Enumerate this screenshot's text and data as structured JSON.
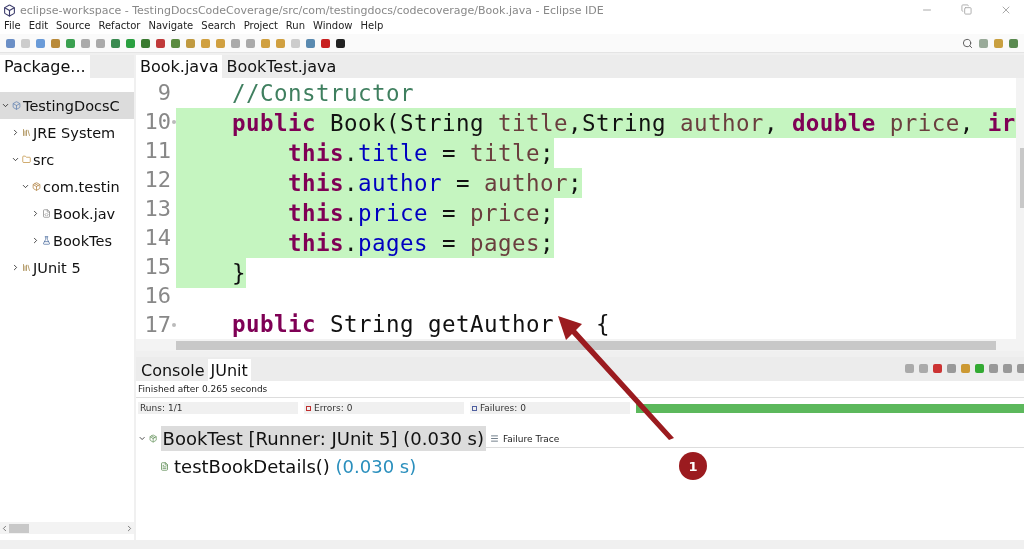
{
  "window": {
    "title": "eclipse-workspace - TestingDocsCodeCoverage/src/com/testingdocs/codecoverage/Book.java - Eclipse IDE"
  },
  "menu": [
    "File",
    "Edit",
    "Source",
    "Refactor",
    "Navigate",
    "Search",
    "Project",
    "Run",
    "Window",
    "Help"
  ],
  "package_explorer": {
    "tab": "Package...",
    "tree": [
      {
        "label": "TestingDocsC",
        "kind": "project",
        "expanded": true,
        "selected": true,
        "children": [
          {
            "label": "JRE System",
            "kind": "library",
            "expanded": false,
            "selected": false
          },
          {
            "label": "src",
            "kind": "folder",
            "expanded": true,
            "selected": false,
            "children": [
              {
                "label": "com.testin",
                "kind": "package",
                "expanded": true,
                "selected": false,
                "children": [
                  {
                    "label": "Book.jav",
                    "kind": "class",
                    "expanded": false,
                    "selected": false
                  },
                  {
                    "label": "BookTes",
                    "kind": "test",
                    "expanded": false,
                    "selected": false
                  }
                ]
              }
            ]
          },
          {
            "label": "JUnit 5",
            "kind": "library",
            "expanded": false,
            "selected": false
          }
        ]
      }
    ]
  },
  "editor": {
    "tabs": [
      {
        "label": "Book.java",
        "selected": true
      },
      {
        "label": "BookTest.java",
        "selected": false
      }
    ],
    "lines": [
      {
        "number": "9",
        "fold": false,
        "covered": false,
        "tokens": [
          {
            "kind": "comment",
            "text": "    //Constructor"
          }
        ]
      },
      {
        "number": "10",
        "fold": true,
        "covered": true,
        "tokens": [
          {
            "kind": "keyword",
            "text": "    public"
          },
          {
            "kind": "plain",
            "text": " Book(String "
          },
          {
            "kind": "variable",
            "text": "title"
          },
          {
            "kind": "plain",
            "text": ",String "
          },
          {
            "kind": "variable",
            "text": "author"
          },
          {
            "kind": "plain",
            "text": ", "
          },
          {
            "kind": "keyword",
            "text": "double"
          },
          {
            "kind": "variable",
            "text": " price"
          },
          {
            "kind": "plain",
            "text": ", "
          },
          {
            "kind": "keyword",
            "text": "ir"
          }
        ]
      },
      {
        "number": "11",
        "fold": false,
        "covered": true,
        "tokens": [
          {
            "kind": "keyword",
            "text": "        this"
          },
          {
            "kind": "plain",
            "text": "."
          },
          {
            "kind": "field",
            "text": "title"
          },
          {
            "kind": "plain",
            "text": " = "
          },
          {
            "kind": "variable",
            "text": "title"
          },
          {
            "kind": "plain",
            "text": ";"
          }
        ]
      },
      {
        "number": "12",
        "fold": false,
        "covered": true,
        "tokens": [
          {
            "kind": "keyword",
            "text": "        this"
          },
          {
            "kind": "plain",
            "text": "."
          },
          {
            "kind": "field",
            "text": "author"
          },
          {
            "kind": "plain",
            "text": " = "
          },
          {
            "kind": "variable",
            "text": "author"
          },
          {
            "kind": "plain",
            "text": ";"
          }
        ]
      },
      {
        "number": "13",
        "fold": false,
        "covered": true,
        "tokens": [
          {
            "kind": "keyword",
            "text": "        this"
          },
          {
            "kind": "plain",
            "text": "."
          },
          {
            "kind": "field",
            "text": "price"
          },
          {
            "kind": "plain",
            "text": " = "
          },
          {
            "kind": "variable",
            "text": "price"
          },
          {
            "kind": "plain",
            "text": ";"
          }
        ]
      },
      {
        "number": "14",
        "fold": false,
        "covered": true,
        "tokens": [
          {
            "kind": "keyword",
            "text": "        this"
          },
          {
            "kind": "plain",
            "text": "."
          },
          {
            "kind": "field",
            "text": "pages"
          },
          {
            "kind": "plain",
            "text": " = "
          },
          {
            "kind": "variable",
            "text": "pages"
          },
          {
            "kind": "plain",
            "text": ";"
          }
        ]
      },
      {
        "number": "15",
        "fold": false,
        "covered": true,
        "tokens": [
          {
            "kind": "plain",
            "text": "    }"
          }
        ]
      },
      {
        "number": "16",
        "fold": false,
        "covered": false
      },
      {
        "number": "17",
        "fold": true,
        "covered": false,
        "tokens": [
          {
            "kind": "keyword",
            "text": "    public"
          },
          {
            "kind": "plain",
            "text": " String getAuthor"
          },
          {
            "kind": "plain",
            "text": "   {"
          }
        ]
      }
    ]
  },
  "bottom_panel": {
    "tabs": [
      {
        "label": "Console",
        "selected": false
      },
      {
        "label": "JUnit",
        "selected": true
      }
    ],
    "status": "Finished after 0.265 seconds",
    "counters": [
      {
        "label": "Runs:",
        "value": "1/1",
        "kind": "runs"
      },
      {
        "label": "Errors:",
        "value": "0",
        "kind": "errors"
      },
      {
        "label": "Failures:",
        "value": "0",
        "kind": "failures"
      }
    ],
    "progress": {
      "level": 1
    },
    "tests": [
      {
        "name": "BookTest [Runner: JUnit 5]",
        "time": "(0.030 s)",
        "selected": true,
        "children": [
          {
            "name": "testBookDetails()",
            "time": "(0.030 s)",
            "selected": false
          }
        ]
      }
    ],
    "failure_trace": {
      "title": "Failure Trace"
    }
  },
  "annotation": {
    "badge": "1"
  }
}
